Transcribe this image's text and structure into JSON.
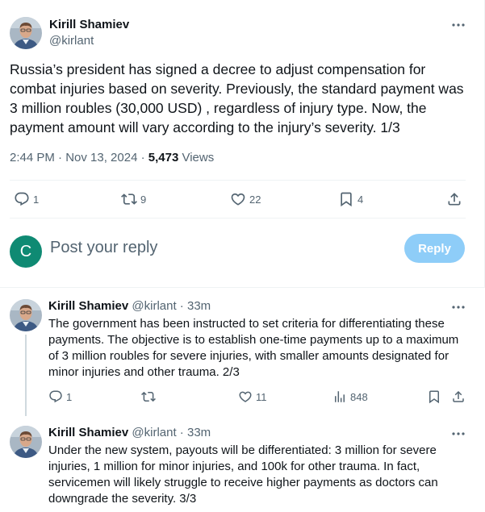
{
  "main_tweet": {
    "author_name": "Kirill Shamiev",
    "author_handle": "@kirlant",
    "text": "Russia’s president has signed a decree to adjust compensation for combat injuries based on severity. Previously, the standard payment was 3 million roubles (30,000 USD) , regardless of injury type. Now, the payment amount will vary according to the injury’s severity. 1/3",
    "timestamp": "2:44 PM · Nov 13, 2024 · ",
    "views_count": "5,473",
    "views_label": " Views",
    "actions": {
      "replies": "1",
      "reposts": "9",
      "likes": "22",
      "bookmarks": "4"
    }
  },
  "reply_composer": {
    "avatar_letter": "C",
    "placeholder": "Post your reply",
    "button_label": "Reply"
  },
  "thread": [
    {
      "author_name": "Kirill Shamiev",
      "author_handle": "@kirlant",
      "separator": " · ",
      "time": "33m",
      "text": "The government has been instructed to set criteria for differentiating these payments. The objective is to establish one-time payments up to a maximum of 3 million roubles for severe injuries, with smaller amounts designated for minor injuries and other trauma. 2/3",
      "actions": {
        "replies": "1",
        "reposts": "",
        "likes": "11",
        "views": "848"
      }
    },
    {
      "author_name": "Kirill Shamiev",
      "author_handle": "@kirlant",
      "separator": " · ",
      "time": "33m",
      "text": "Under the new system, payouts will be differentiated: 3 million for severe injuries, 1 million for minor injuries, and 100k for other trauma. In fact, servicemen will likely struggle to receive higher payments as doctors can downgrade the severity. 3/3"
    }
  ],
  "colors": {
    "text_primary": "#0f1419",
    "text_secondary": "#536471",
    "reply_button": "#8ecdf8",
    "composer_avatar": "#0f8a73",
    "divider": "#eff3f4"
  }
}
